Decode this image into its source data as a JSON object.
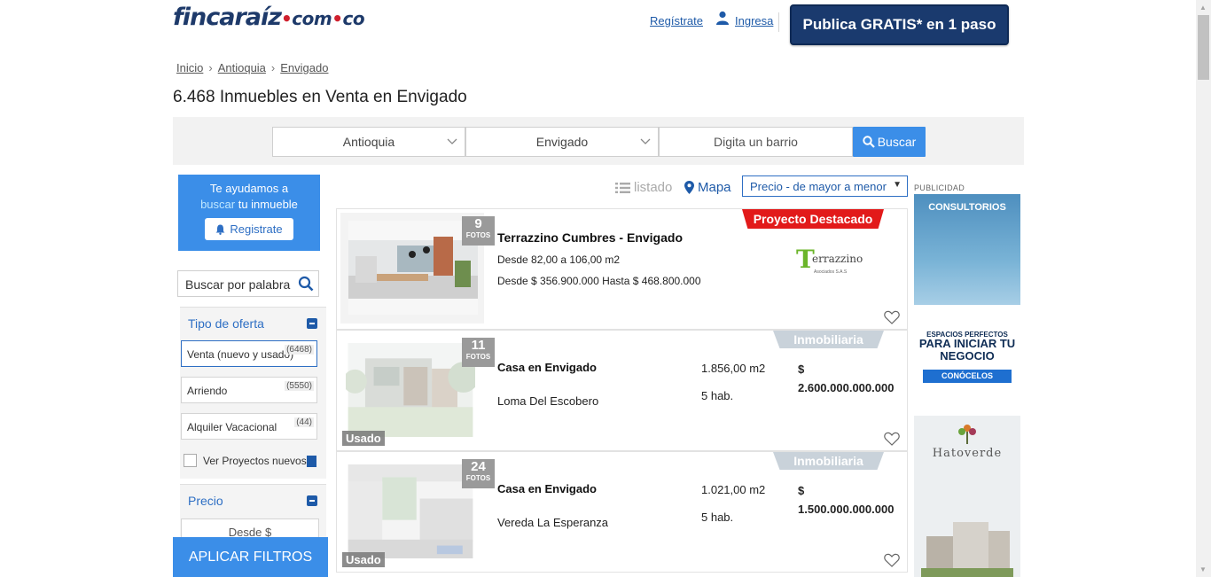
{
  "header": {
    "logo_main": "fincaraíz",
    "logo_com": "com",
    "logo_co": "co",
    "register_link": "Regístrate",
    "login_link": "Ingresa",
    "publish_button": "Publica GRATIS* en 1 paso"
  },
  "breadcrumb": {
    "home": "Inicio",
    "dept": "Antioquia",
    "city": "Envigado",
    "separator": "›"
  },
  "page_title": "6.468 Inmuebles en Venta en Envigado",
  "search": {
    "department_value": "Antioquia",
    "city_value": "Envigado",
    "neighborhood_placeholder": "Digita un barrio",
    "search_button": "Buscar"
  },
  "sidebar": {
    "help_line1": "Te ayudamos a",
    "help_highlight": "buscar",
    "help_line2": " tu inmueble",
    "help_button": "Registrate",
    "keyword_placeholder": "Buscar por palabra",
    "offer_type_title": "Tipo de oferta",
    "offer_options": [
      {
        "label": "Venta (nuevo y usado)",
        "count": "(6468)"
      },
      {
        "label": "Arriendo",
        "count": "(5550)"
      },
      {
        "label": "Alquiler Vacacional",
        "count": "(44)"
      }
    ],
    "projects_checkbox": "Ver Proyectos nuevos",
    "price_title": "Precio",
    "price_from_placeholder": "Desde $",
    "apply_button": "APLICAR FILTROS"
  },
  "view": {
    "list_label": "listado",
    "map_label": "Mapa",
    "sort_value": "Precio - de mayor a menor"
  },
  "listings": [
    {
      "photos": "9",
      "photos_label": "FOTOS",
      "ribbon": "Proyecto Destacado",
      "title": "Terrazzino Cumbres - Envigado",
      "area": "Desde 82,00 a 106,00 m2",
      "price": "Desde $ 356.900.000 Hasta $ 468.800.000",
      "logo_text": "errazzino",
      "logo_letter": "T",
      "logo_sub": "Asociados S.A.S"
    },
    {
      "photos": "11",
      "photos_label": "FOTOS",
      "ribbon": "Inmobiliaria",
      "status": "Usado",
      "type": "Casa en Envigado",
      "location": "Loma Del Escobero",
      "area": "1.856,00 m2",
      "rooms": "5 hab.",
      "currency": "$",
      "price": "2.600.000.000.000"
    },
    {
      "photos": "24",
      "photos_label": "FOTOS",
      "ribbon": "Inmobiliaria",
      "status": "Usado",
      "type": "Casa en Envigado",
      "location": "Vereda La Esperanza",
      "area": "1.021,00 m2",
      "rooms": "5 hab.",
      "currency": "$",
      "price": "1.500.000.000.000"
    }
  ],
  "ads": {
    "label": "PUBLICIDAD",
    "ad1_heading": "CONSULTORIOS",
    "ad1_line1": "ESPACIOS PERFECTOS",
    "ad1_line2": "PARA INICIAR TU NEGOCIO",
    "ad1_cta": "CONÓCELOS",
    "ad2_name": "Hatoverde"
  },
  "colors": {
    "brand_navy": "#1a3a6e",
    "accent_blue": "#3b8ee8",
    "link_blue": "#1e5aa8",
    "highlight_red": "#e21a1a"
  }
}
